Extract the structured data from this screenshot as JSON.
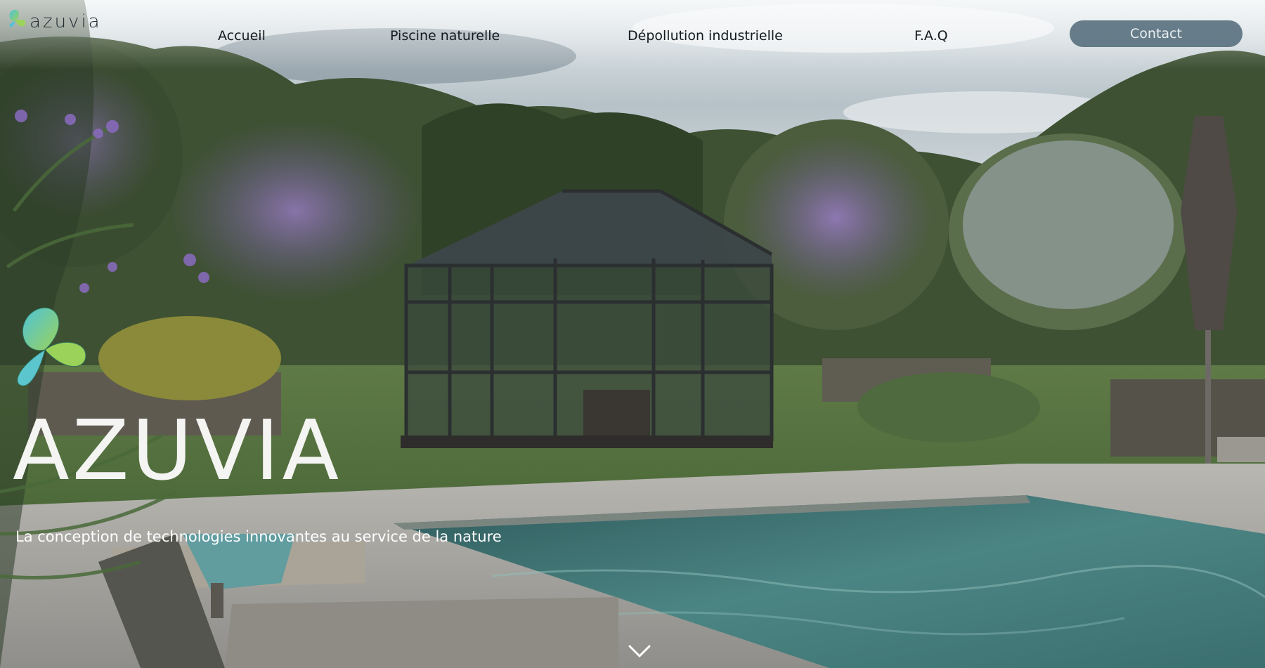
{
  "brand": {
    "logo_text": "azuvia"
  },
  "nav": {
    "items": [
      {
        "label": "Accueil"
      },
      {
        "label": "Piscine naturelle"
      },
      {
        "label": "Dépollution industrielle"
      },
      {
        "label": "F.A.Q"
      }
    ],
    "contact_label": "Contact"
  },
  "hero": {
    "title": "AZUVIA",
    "subtitle": "La conception de technologies innovantes au service de la nature"
  },
  "icons": {
    "logo": "butterfly-logo-icon",
    "scroll": "chevron-down-icon"
  },
  "colors": {
    "contact_button": "#506978",
    "logo_gradient_start": "#4ec3d8",
    "logo_gradient_end": "#9bd25a",
    "text_dark": "#131b1f"
  }
}
